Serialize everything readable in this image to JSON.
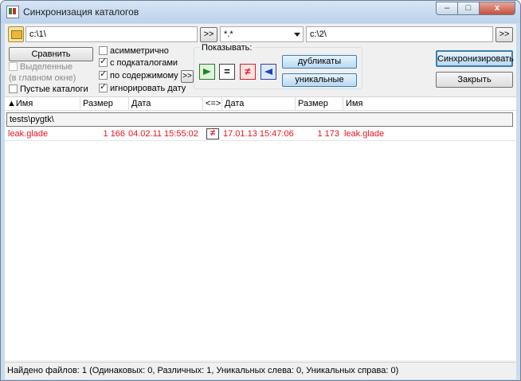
{
  "window": {
    "title": "Синхронизация каталогов",
    "min_label": "–",
    "max_label": "□",
    "close_label": "x"
  },
  "top": {
    "left_path": "c:\\1\\",
    "arrow1_label": ">>",
    "filter_value": "*.*",
    "right_path": "c:\\2\\",
    "arrow2_label": ">>"
  },
  "buttons": {
    "compare": "Сравнить",
    "sync": "Синхронизировать",
    "close": "Закрыть",
    "duplicates": "дубликаты",
    "unique": "уникальные",
    "more": ">>"
  },
  "options": {
    "selected_line1": "Выделенные",
    "selected_line2": "(в главном окне)",
    "empty_dirs": "Пустые каталоги",
    "asymmetric": "асимметрично",
    "subdirs": "с подкаталогами",
    "by_content": "по содержимому",
    "ignore_date": "игнорировать дату"
  },
  "show": {
    "title": "Показывать:",
    "equal_symbol": "=",
    "diff_symbol": "≠"
  },
  "table": {
    "headers": {
      "name_left": "Имя",
      "size_left": "Размер",
      "date_left": "Дата",
      "compare": "<=>",
      "date_right": "Дата",
      "size_right": "Размер",
      "name_right": "Имя"
    },
    "group": "tests\\pygtk\\",
    "rows": [
      {
        "name_left": "leak.glade",
        "size_left": "1 166",
        "date_left": "04.02.11 15:55:02",
        "compare": "≠",
        "date_right": "17.01.13 15:47:06",
        "size_right": "1 173",
        "name_right": "leak.glade"
      }
    ]
  },
  "status": "Найдено файлов: 1  (Одинаковых: 0, Различных: 1, Уникальных слева: 0, Уникальных справа: 0)",
  "colors": {
    "diff_text": "#e8141e",
    "accent": "#3c7fb1"
  }
}
